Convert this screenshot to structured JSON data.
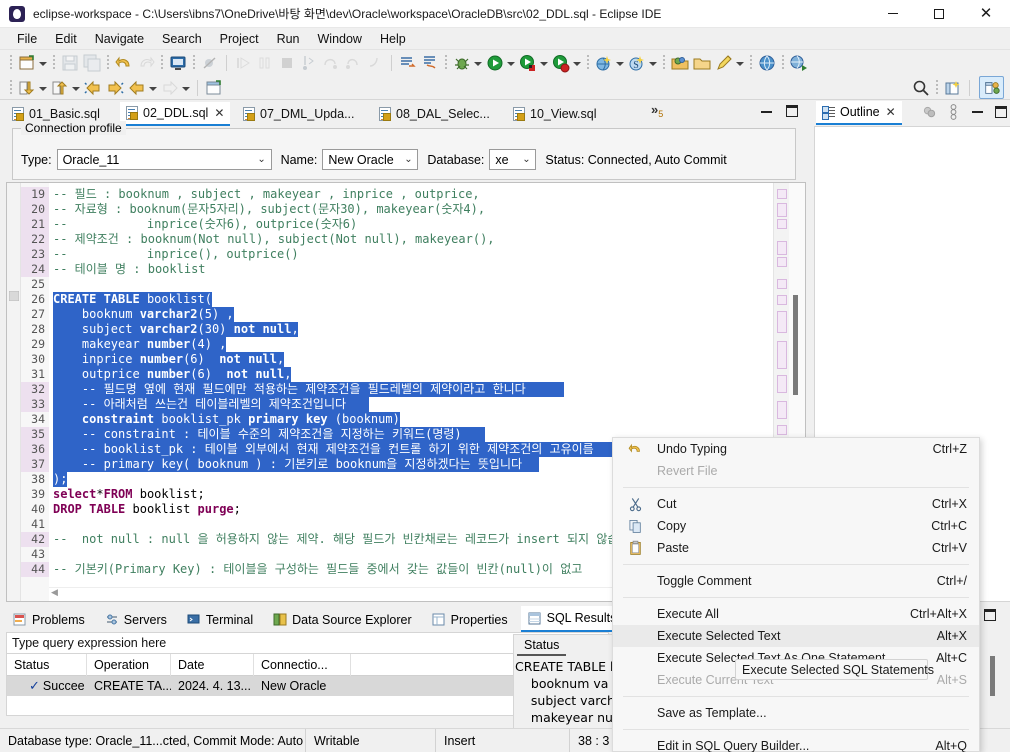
{
  "window": {
    "title": "eclipse-workspace - C:\\Users\\ibns7\\OneDrive\\바탕 화면\\dev\\Oracle\\workspace\\OracleDB\\src\\02_DDL.sql - Eclipse IDE",
    "app_icon": "eclipse-icon",
    "minimize_label": "Minimize",
    "maximize_label": "Maximize",
    "close_label": "Close"
  },
  "menubar": {
    "items": [
      "File",
      "Edit",
      "Navigate",
      "Search",
      "Project",
      "Run",
      "Window",
      "Help"
    ]
  },
  "toolbar": {
    "row1_icons": [
      "new-file-icon",
      "save-icon",
      "save-all-icon",
      "undo-icon",
      "redo-icon",
      "console-icon",
      "skip-breakpoints-icon",
      "resume-icon",
      "suspend-icon",
      "terminate-icon",
      "step-into-icon",
      "step-over-icon",
      "step-return-icon",
      "drop-to-frame-icon",
      "execute-all-icon",
      "execute-selected-icon",
      "debug-icon",
      "run-icon",
      "run-config-icon",
      "profile-icon"
    ],
    "row2_icons": [
      "export-icon",
      "import-icon",
      "back-history-icon",
      "forward-history-icon",
      "previous-icon",
      "next-icon",
      "new-sql-file-icon"
    ],
    "search_icon": "search-icon",
    "open-perspective_icon": "open-perspective-icon",
    "perspective_icon": "database-development-perspective-icon"
  },
  "editor_tabs": {
    "items": [
      {
        "label": "01_Basic.sql",
        "active": false,
        "closable": false
      },
      {
        "label": "02_DDL.sql",
        "active": true,
        "closable": true
      },
      {
        "label": "07_DML_Upda...",
        "active": false,
        "closable": false
      },
      {
        "label": "08_DAL_Selec...",
        "active": false,
        "closable": false
      },
      {
        "label": "10_View.sql",
        "active": false,
        "closable": false
      }
    ],
    "overflow": "»",
    "overflow_count": "5",
    "minimize_label": "Minimize",
    "maximize_label": "Maximize"
  },
  "connection_profile": {
    "legend": "Connection profile",
    "type_label": "Type:",
    "type_value": "Oracle_11",
    "name_label": "Name:",
    "name_value": "New Oracle",
    "database_label": "Database:",
    "database_value": "xe",
    "status_text": "Status: Connected, Auto Commit"
  },
  "editor": {
    "first_line": 19,
    "lines": [
      {
        "n": 19,
        "text": "-- 필드 : booknum , subject , makeyear , inprice , outprice,",
        "kind": "comment",
        "selected": false,
        "marked": true
      },
      {
        "n": 20,
        "text": "-- 자료형 : booknum(문자5자리), subject(문자30), makeyear(숫자4),",
        "kind": "comment",
        "selected": false,
        "marked": true
      },
      {
        "n": 21,
        "text": "--           inprice(숫자6), outprice(숫자6)",
        "kind": "comment",
        "selected": false,
        "marked": true
      },
      {
        "n": 22,
        "text": "-- 제약조건 : booknum(Not null), subject(Not null), makeyear(),",
        "kind": "comment",
        "selected": false,
        "marked": true
      },
      {
        "n": 23,
        "text": "--           inprice(), outprice()",
        "kind": "comment",
        "selected": false,
        "marked": true
      },
      {
        "n": 24,
        "text": "-- 테이블 명 : booklist",
        "kind": "comment",
        "selected": false,
        "marked": true
      },
      {
        "n": 25,
        "text": "",
        "kind": "blank",
        "selected": false,
        "marked": false
      },
      {
        "n": 26,
        "text": "CREATE TABLE booklist(",
        "kind": "code",
        "selected": true,
        "marked": false
      },
      {
        "n": 27,
        "text": "    booknum varchar2(5) ,",
        "kind": "code",
        "selected": true,
        "marked": false
      },
      {
        "n": 28,
        "text": "    subject varchar2(30) not null,",
        "kind": "code",
        "selected": true,
        "marked": false
      },
      {
        "n": 29,
        "text": "    makeyear number(4) ,",
        "kind": "code",
        "selected": true,
        "marked": false
      },
      {
        "n": 30,
        "text": "    inprice number(6)  not null,",
        "kind": "code",
        "selected": true,
        "marked": false
      },
      {
        "n": 31,
        "text": "    outprice number(6)  not null,",
        "kind": "code",
        "selected": true,
        "marked": false
      },
      {
        "n": 32,
        "text": "    -- 필드명 옆에 현재 필드에만 적용하는 제약조건을 필드레벨의 제약이라고 한니다",
        "kind": "comment",
        "selected": true,
        "marked": true
      },
      {
        "n": 33,
        "text": "    -- 아래처럼 쓰는건 테이블레벨의 제약조건입니다",
        "kind": "comment",
        "selected": true,
        "marked": true
      },
      {
        "n": 34,
        "text": "    constraint booklist_pk primary key (booknum)",
        "kind": "code",
        "selected": true,
        "marked": false
      },
      {
        "n": 35,
        "text": "    -- constraint : 테이블 수준의 제약조건을 지정하는 키워드(명령)",
        "kind": "comment",
        "selected": true,
        "marked": true
      },
      {
        "n": 36,
        "text": "    -- booklist_pk : 테이블 외부에서 현재 제약조건을 컨트롤 하기 위한 제약조건의 고유이름",
        "kind": "comment",
        "selected": true,
        "marked": true
      },
      {
        "n": 37,
        "text": "    -- primary key( booknum ) : 기본키로 booknum을 지정하겠다는 뜻입니다",
        "kind": "comment",
        "selected": true,
        "marked": true
      },
      {
        "n": 38,
        "text": ");",
        "kind": "code",
        "selected": true,
        "marked": false
      },
      {
        "n": 39,
        "text": "select*FROM booklist;",
        "kind": "code",
        "selected": false,
        "marked": false
      },
      {
        "n": 40,
        "text": "DROP TABLE booklist purge;",
        "kind": "code",
        "selected": false,
        "marked": false
      },
      {
        "n": 41,
        "text": "",
        "kind": "blank",
        "selected": false,
        "marked": false
      },
      {
        "n": 42,
        "text": "--  not null : null 을 허용하지 않는 제약. 해당 필드가 빈칸채로는 레코드가 insert 되지 않습니다.",
        "kind": "comment",
        "selected": false,
        "marked": true
      },
      {
        "n": 43,
        "text": "",
        "kind": "blank",
        "selected": false,
        "marked": false
      },
      {
        "n": 44,
        "text": "-- 기본키(Primary Key) : 테이블을 구성하는 필드들 중에서 갖는 값들이 빈칸(null)이 없고",
        "kind": "comment",
        "selected": false,
        "marked": true
      }
    ],
    "selection_color": "#2f64c8",
    "comment_color": "#3f7f5f",
    "keyword_color": "#7f0055"
  },
  "outline": {
    "tab_label": "Outline",
    "tab_icon": "outline-icon",
    "close_icon": "close-icon",
    "menu_icon": "view-menu-icon",
    "filter_icon": "focus-icon",
    "minimize_label": "Minimize",
    "maximize_label": "Maximize"
  },
  "bottom_panel": {
    "tabs": [
      {
        "label": "Problems",
        "icon": "problems-icon",
        "active": false
      },
      {
        "label": "Servers",
        "icon": "servers-icon",
        "active": false
      },
      {
        "label": "Terminal",
        "icon": "terminal-icon",
        "active": false
      },
      {
        "label": "Data Source Explorer",
        "icon": "data-source-explorer-icon",
        "active": false
      },
      {
        "label": "Properties",
        "icon": "properties-icon",
        "active": false
      },
      {
        "label": "SQL Results",
        "icon": "sql-results-icon",
        "active": true
      }
    ],
    "query_expression_placeholder": "Type query expression here",
    "results": {
      "columns": [
        "Status",
        "Operation",
        "Date",
        "Connectio..."
      ],
      "rows": [
        {
          "status": "Succee",
          "status_icon": "success-check-icon",
          "operation": "CREATE TA...",
          "date": "2024. 4. 13...",
          "connection": "New Oracle"
        }
      ]
    },
    "status_pane": {
      "tab_label": "Status",
      "lines": [
        "CREATE TABLE bo",
        "    booknum va",
        "    subject varch",
        "    makeyear nu"
      ]
    }
  },
  "context_menu": {
    "items": [
      {
        "label": "Undo Typing",
        "accel": "Ctrl+Z",
        "icon": "undo-icon",
        "disabled": false,
        "selected": false,
        "separator_after": false
      },
      {
        "label": "Revert File",
        "accel": "",
        "icon": "",
        "disabled": true,
        "selected": false,
        "separator_after": true
      },
      {
        "label": "Cut",
        "accel": "Ctrl+X",
        "icon": "cut-icon",
        "disabled": false,
        "selected": false,
        "separator_after": false
      },
      {
        "label": "Copy",
        "accel": "Ctrl+C",
        "icon": "copy-icon",
        "disabled": false,
        "selected": false,
        "separator_after": false
      },
      {
        "label": "Paste",
        "accel": "Ctrl+V",
        "icon": "paste-icon",
        "disabled": false,
        "selected": false,
        "separator_after": true
      },
      {
        "label": "Toggle Comment",
        "accel": "Ctrl+/",
        "icon": "",
        "disabled": false,
        "selected": false,
        "separator_after": true
      },
      {
        "label": "Execute All",
        "accel": "Ctrl+Alt+X",
        "icon": "",
        "disabled": false,
        "selected": false,
        "separator_after": false
      },
      {
        "label": "Execute Selected Text",
        "accel": "Alt+X",
        "icon": "",
        "disabled": false,
        "selected": true,
        "separator_after": false
      },
      {
        "label": "Execute Selected Text As One Statement",
        "accel": "Alt+C",
        "icon": "",
        "disabled": false,
        "selected": false,
        "separator_after": false
      },
      {
        "label": "Execute Current Text",
        "accel": "Alt+S",
        "icon": "",
        "disabled": true,
        "selected": false,
        "separator_after": true
      },
      {
        "label": "Save as Template...",
        "accel": "",
        "icon": "",
        "disabled": false,
        "selected": false,
        "separator_after": true
      },
      {
        "label": "Edit in SQL Query Builder...",
        "accel": "Alt+Q",
        "icon": "",
        "disabled": false,
        "selected": false,
        "separator_after": false
      }
    ]
  },
  "tooltip": {
    "text": "Execute Selected SQL Statements"
  },
  "statusbar": {
    "cells": [
      "Database type: Oracle_11...cted, Commit Mode: Auto",
      "Writable",
      "Insert",
      "38 : 3"
    ]
  },
  "colors": {
    "accent": "#1a7fd4",
    "selection": "#2f64c8",
    "chrome": "#f0f0f0",
    "editor_bg": "#ffffff"
  }
}
